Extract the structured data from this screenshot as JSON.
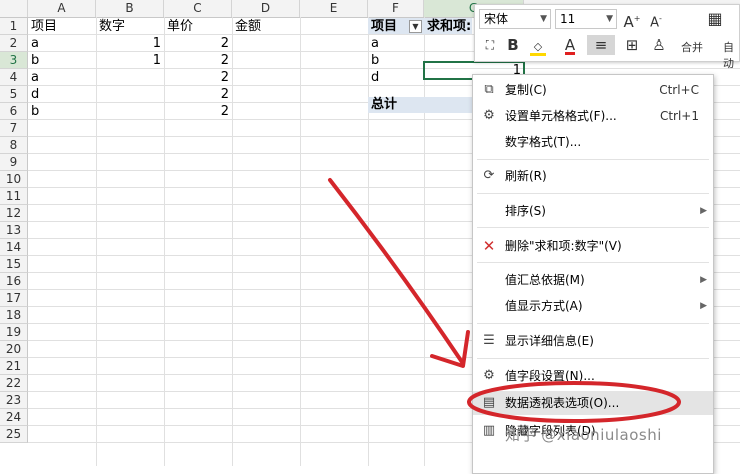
{
  "columns": [
    "A",
    "B",
    "C",
    "D",
    "E",
    "F",
    "G"
  ],
  "rows": [
    "1",
    "2",
    "3",
    "4",
    "5",
    "6",
    "7",
    "8",
    "9",
    "10",
    "11",
    "12",
    "13",
    "14",
    "15",
    "16",
    "17",
    "18",
    "19",
    "20",
    "21",
    "22",
    "23",
    "24",
    "25"
  ],
  "sheet": {
    "a1": "项目",
    "b1": "数字",
    "c1": "单价",
    "d1": "金额",
    "a2": "a",
    "b2": "1",
    "c2": "2",
    "a3": "b",
    "b3": "1",
    "c3": "2",
    "a4": "a",
    "c4": "2",
    "a5": "d",
    "c5": "2",
    "a6": "b",
    "c6": "2"
  },
  "pivot": {
    "header_item": "项目",
    "header_sum": "求和项:",
    "filter_glyph": "▼",
    "r2": "a",
    "r3": "b",
    "r3_val": "1",
    "r4": "d",
    "total": "总计"
  },
  "mini_toolbar": {
    "font": "宋体",
    "size": "11",
    "grow": "A",
    "shrink": "A",
    "bold": "B",
    "fontcolor": "A",
    "merge": "合并",
    "auto": "自动"
  },
  "menu": {
    "copy": "复制(C)",
    "copy_sc": "Ctrl+C",
    "format_cells": "设置单元格格式(F)...",
    "format_sc": "Ctrl+1",
    "number_format": "数字格式(T)...",
    "refresh": "刷新(R)",
    "sort": "排序(S)",
    "delete": "删除\"求和项:数字\"(V)",
    "summarize": "值汇总依据(M)",
    "show_as": "值显示方式(A)",
    "details": "显示详细信息(E)",
    "field_settings": "值字段设置(N)...",
    "pivot_options": "数据透视表选项(O)...",
    "hide_list": "隐藏字段列表(D)"
  },
  "watermark": "知乎 @xiaoniulaoshi",
  "colors": {
    "accent": "#217346",
    "pivot_header": "#dde6f1",
    "annotation": "#d4262b"
  }
}
